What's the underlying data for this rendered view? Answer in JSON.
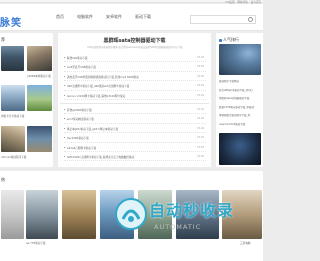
{
  "topbar": {
    "link_1": "FUI设置",
    "link_2": "网站导航",
    "link_3": "设为首页"
  },
  "logo": {
    "text": "脉笑"
  },
  "nav": [
    {
      "label": "首页",
      "active": false
    },
    {
      "label": "电脑软件",
      "active": false
    },
    {
      "label": "安卓软件",
      "active": false
    },
    {
      "label": "驱动下载",
      "active": false
    }
  ],
  "left": {
    "title": "荐",
    "captions": [
      "",
      "y4868本地驱动下载",
      "",
      "内驱卡光卡驱动下载",
      "",
      "nforce3驱动程序下载"
    ]
  },
  "main": {
    "title": "黑群晖sata控制器驱动下载",
    "desc": "PCI标准管理卡驱动程序版本:适合所有windows系统安装的SATA控制器驱动软件可以下载",
    "items": [
      {
        "text": "联想S40驱动下载",
        "date": "05-06"
      },
      {
        "text": "sio6型蓝牙USB驱动下载",
        "date": "05-06"
      },
      {
        "text": "通用蓝牙USB外置调制解调器驱动包下载_利用mp3 6699驱动",
        "date": "05-06"
      },
      {
        "text": "360无线网卡驱动下载_360随身wifi无线网卡驱动下载",
        "date": "05-06"
      },
      {
        "text": "lenovo v3100网卡驱动下载_联想b3100网卡驱动",
        "date": "05-06"
      },
      {
        "text": "影驰gtx960驱动下载",
        "date": "05-06"
      },
      {
        "text": "win7驱动精灵驱动下载",
        "date": "05-06"
      },
      {
        "text": "笔记本gt5x驱动下载_g63-5笔记本驱动下载",
        "date": "05-06"
      },
      {
        "text": "hpc2280驱动下载",
        "date": "05-06"
      },
      {
        "text": "b43a4万能网卡驱动下载",
        "date": "05-06"
      },
      {
        "text": "SMC1500n无线网卡驱动下载_联想北京汉王电脑触控驱动",
        "date": "05-06"
      }
    ]
  },
  "right": {
    "title": "人气排行",
    "hot": [
      "驱动程序下载网站",
      "新力a88gmp驱动下载_(中文)",
      "黑群晖sata控制器驱动下载",
      "联想x370网卡驱动下载_本驱动",
      "零零帧数合驱动程序下载_利",
      "inspiron1525驱动下载"
    ]
  },
  "bottom": {
    "title": "热",
    "captions": [
      "",
      "ap-735驱动下载",
      "",
      "",
      "",
      "",
      "三星电脑"
    ]
  },
  "watermark": {
    "text": "自动秒收录",
    "sub": "AUTOMATIC"
  }
}
